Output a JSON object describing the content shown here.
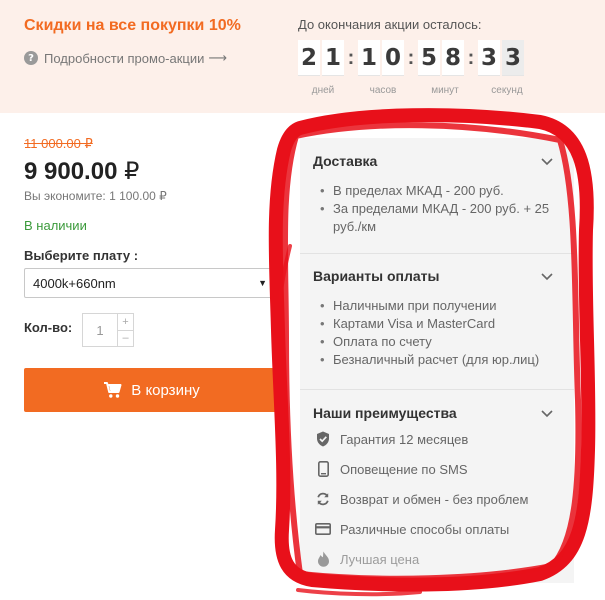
{
  "promo": {
    "title": "Скидки на все покупки 10%",
    "details_link": "Подробности промо-акции",
    "details_arrow": "⟶",
    "help_glyph": "?"
  },
  "countdown": {
    "title": "До окончания акции осталось:",
    "digits": [
      "2",
      "1",
      "1",
      "0",
      "5",
      "8",
      "3",
      "3"
    ],
    "separator": ":",
    "units": [
      "дней",
      "часов",
      "минут",
      "секунд"
    ]
  },
  "product": {
    "old_price": "11 000.00 ₽",
    "new_price_value": "9 900.00",
    "currency": "₽",
    "savings": "Вы экономите: 1 100.00 ₽",
    "availability": "В наличии",
    "board_label": "Выберите плату :",
    "board_selected": "4000k+660nm",
    "board_caret": "▼",
    "qty_label": "Кол-во:",
    "qty_value": "1",
    "qty_plus": "+",
    "qty_minus": "–",
    "cart_label": "В корзину"
  },
  "info_panel": {
    "delivery": {
      "title": "Доставка",
      "items": [
        "В пределах МКАД - 200 руб.",
        "За пределами МКАД - 200 руб. + 25 руб./км"
      ]
    },
    "payment": {
      "title": "Варианты оплаты",
      "items": [
        "Наличными при получении",
        "Картами Visa и MasterCard",
        "Оплата по счету",
        "Безналичный расчет (для юр.лиц)"
      ]
    },
    "advantages": {
      "title": "Наши преимущества",
      "items": [
        {
          "icon": "shield-check-icon",
          "label": "Гарантия 12 месяцев"
        },
        {
          "icon": "phone-icon",
          "label": "Оповещение по SMS"
        },
        {
          "icon": "refresh-icon",
          "label": "Возврат и обмен - без проблем"
        },
        {
          "icon": "credit-card-icon",
          "label": "Различные способы оплаты"
        },
        {
          "icon": "flame-icon",
          "label": "Лучшая цена"
        }
      ]
    }
  },
  "colors": {
    "accent": "#f26b22",
    "promo_bg": "#fdf0ea",
    "in_stock": "#3b9a3b",
    "panel_bg": "#f4f4f4",
    "annotation": "#e8101a"
  }
}
